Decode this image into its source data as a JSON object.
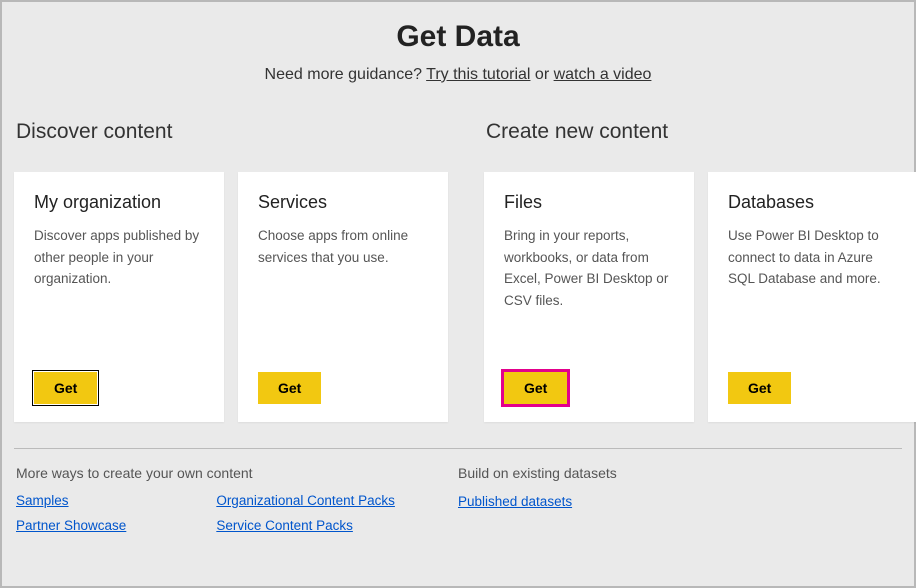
{
  "header": {
    "title": "Get Data",
    "guidance_prefix": "Need more guidance? ",
    "tutorial_link": "Try this tutorial",
    "middle_text": " or ",
    "video_link": "watch a video"
  },
  "discover": {
    "title": "Discover content",
    "cards": [
      {
        "title": "My organization",
        "desc": "Discover apps published by other people in your organization.",
        "button": "Get"
      },
      {
        "title": "Services",
        "desc": "Choose apps from online services that you use.",
        "button": "Get"
      }
    ]
  },
  "create": {
    "title": "Create new content",
    "cards": [
      {
        "title": "Files",
        "desc": "Bring in your reports, workbooks, or data from Excel, Power BI Desktop or CSV files.",
        "button": "Get"
      },
      {
        "title": "Databases",
        "desc": "Use Power BI Desktop to connect to data in Azure SQL Database and more.",
        "button": "Get"
      }
    ]
  },
  "footer": {
    "more_ways_title": "More ways to create your own content",
    "links_col1": [
      "Samples",
      "Partner Showcase"
    ],
    "links_col2": [
      "Organizational Content Packs",
      "Service Content Packs"
    ],
    "build_title": "Build on existing datasets",
    "build_link": "Published datasets"
  }
}
